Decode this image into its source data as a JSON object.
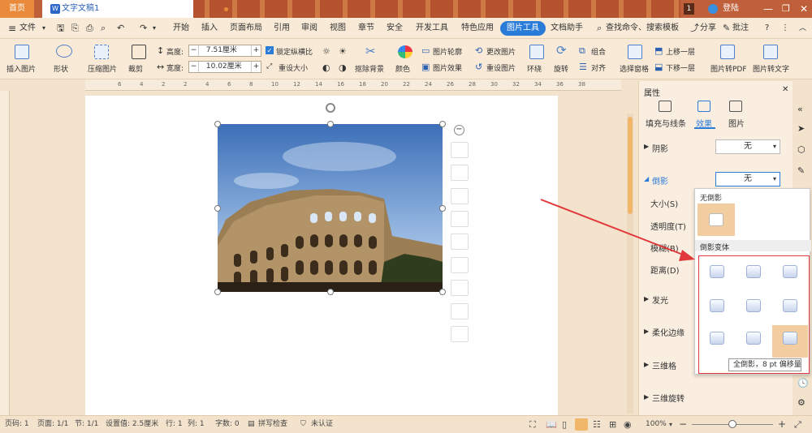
{
  "titlebar": {
    "home_tab": "首页",
    "doc_tab": "文字文稿1",
    "right_badge": "1",
    "right_user": "登陆"
  },
  "menubar": {
    "file_label": "文件",
    "items": [
      "开始",
      "插入",
      "页面布局",
      "引用",
      "审阅",
      "视图",
      "章节",
      "安全",
      "开发工具",
      "特色应用"
    ],
    "active_tab": "图片工具",
    "helper": "文档助手",
    "search": "查找命令、搜索模板",
    "share": "分享",
    "comment": "批注",
    "help": "?"
  },
  "ribbon": {
    "insert_pic": "插入图片",
    "shape": "形状",
    "compress": "压缩图片",
    "crop": "裁剪",
    "height_label": "高度:",
    "height_value": "7.51厘米",
    "width_label": "宽度:",
    "width_value": "10.02厘米",
    "lock_ratio": "锁定纵横比",
    "reset_size": "重设大小",
    "remove_bg": "抠除背景",
    "color": "颜色",
    "pic_outline": "图片轮廓",
    "pic_effect": "图片效果",
    "change_pic": "更改图片",
    "reset_pic": "重设图片",
    "wrap": "环绕",
    "rotate": "旋转",
    "group": "组合",
    "align": "对齐",
    "select_pane": "选择窗格",
    "bring_forward": "上移一层",
    "send_backward": "下移一层",
    "to_pdf": "图片转PDF",
    "to_text": "图片转文字"
  },
  "ruler_numbers": [
    "6",
    "4",
    "2",
    "2",
    "4",
    "6",
    "8",
    "10",
    "12",
    "14",
    "16",
    "18",
    "20",
    "22",
    "24",
    "26",
    "28",
    "30",
    "32",
    "34",
    "36",
    "38"
  ],
  "panel": {
    "title": "属性",
    "tabs": [
      "填充与线条",
      "效果",
      "图片"
    ],
    "active_tab": "效果",
    "shadow_label": "阴影",
    "shadow_value": "无",
    "reflection_label": "倒影",
    "reflection_value": "无",
    "size_label": "大小(S)",
    "transparency_label": "透明度(T)",
    "blur_label": "模糊(B)",
    "distance_label": "距离(D)",
    "glow_label": "发光",
    "soft_edge_label": "柔化边缘",
    "three_d_format": "三维格",
    "three_d_rotate": "三维旋转"
  },
  "popup": {
    "no_reflection": "无倒影",
    "variants_label": "倒影变体",
    "tooltip": "全倒影，8 pt 偏移量"
  },
  "status": {
    "page_code": "页码: 1",
    "pages": "页面: 1/1",
    "section": "节: 1/1",
    "setting": "设置值: 2.5厘米",
    "row": "行: 1",
    "col": "列: 1",
    "words": "字数: 0",
    "spell": "拼写检查",
    "cert": "未认证",
    "zoom": "100%"
  },
  "colors": {
    "accent": "#2b7bd9",
    "arrow": "#e0383b",
    "titlebar": "#c0603a"
  }
}
